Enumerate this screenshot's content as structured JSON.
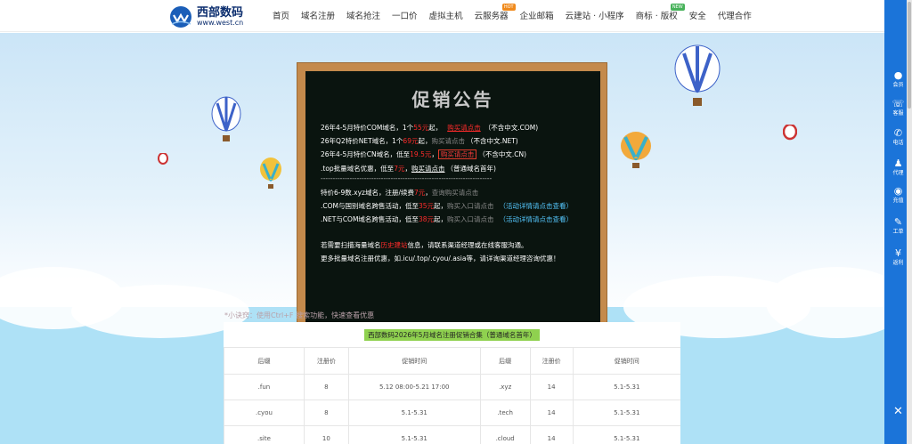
{
  "logo": {
    "name": "西部数码",
    "url": "www.west.cn"
  },
  "nav": [
    {
      "label": "首页"
    },
    {
      "label": "域名注册"
    },
    {
      "label": "域名抢注"
    },
    {
      "label": "一口价"
    },
    {
      "label": "虚拟主机"
    },
    {
      "label": "云服务器",
      "badge": "HOT"
    },
    {
      "label": "企业邮箱"
    },
    {
      "label": "云建站 · 小程序"
    },
    {
      "label": "商标 · 版权",
      "badge": "NEW"
    },
    {
      "label": "安全"
    },
    {
      "label": "代理合作"
    }
  ],
  "right_sidebar": [
    {
      "label": "会员",
      "icon": "user-icon"
    },
    {
      "label": "客服",
      "icon": "headset-icon"
    },
    {
      "label": "电话",
      "icon": "phone-icon"
    },
    {
      "label": "代理",
      "icon": "agent-icon"
    },
    {
      "label": "充值",
      "icon": "moneybag-icon"
    },
    {
      "label": "工单",
      "icon": "ticket-icon"
    },
    {
      "label": "返利",
      "icon": "rebate-icon"
    }
  ],
  "close_glyph": "✕",
  "notice": {
    "title": "促销公告",
    "line1": {
      "a": "26年4-5月特价COM域名，1个",
      "price": "55元",
      "b": "起，",
      "link": "购买请点击",
      "note": "（不含中文.COM)"
    },
    "line2": {
      "a": "26年Q2特价NET域名，1个",
      "price": "69元",
      "b": "起，",
      "link": "购买请点击",
      "note": "（不含中文.NET)"
    },
    "line3": {
      "a": "26年4-5月特价CN域名，低至",
      "price": "19.5元",
      "b": "，",
      "link": "购买请点击",
      "note": "（不含中文.CN)"
    },
    "line4": {
      "a": ".top批量域名优惠，低至",
      "price": "7元",
      "b": "，",
      "link": "购买请点击",
      "note": "（普通域名首年)"
    },
    "divider": "-----------------------------------------------------------------------",
    "line5": {
      "a": "特价6-9数.xyz域名，注册/续费",
      "price": "7元",
      "b": "，",
      "link": "查询购买请点击"
    },
    "line6": {
      "a": ".COM与国别域名跨售活动，低至",
      "price": "35元",
      "b": "起，",
      "link": "购买入口请点击",
      "note": "（活动详情请点击查看）"
    },
    "line7": {
      "a": ".NET与COM域名跨售活动，低至",
      "price": "38元",
      "b": "起，",
      "link": "购买入口请点击",
      "note": "（活动详情请点击查看）"
    },
    "line8": {
      "a": "若需要扫描海量域名",
      "red": "历史建站",
      "b": "信息，请联系渠道经理或在线客服沟通。"
    },
    "line9": "更多批量域名注册优惠，如.icu/.top/.cyou/.asia等，请详询渠道经理咨询优惠！"
  },
  "tip": "*小诀窍：使用Ctrl+F 搜索功能，快速查看优惠",
  "promo": {
    "title": "西部数码2026年5月域名注册促销合集（普通域名首年）",
    "headers": [
      "后缀",
      "注册价",
      "促销时间",
      "后缀",
      "注册价",
      "促销时间"
    ],
    "rows": [
      [
        ".fun",
        "8",
        "5.12 08:00-5.21 17:00",
        ".xyz",
        "14",
        "5.1-5.31"
      ],
      [
        ".cyou",
        "8",
        "5.1-5.31",
        ".tech",
        "14",
        "5.1-5.31"
      ],
      [
        ".site",
        "10",
        "5.1-5.31",
        ".cloud",
        "14",
        "5.1-5.31"
      ]
    ]
  },
  "colors": {
    "primary_blue": "#1b74d9",
    "board_bg": "#0a140f",
    "frame": "#c48a4c",
    "price_red": "#ff2b2b",
    "highlight_green": "#8fd14f",
    "sky": "#aee1f6"
  }
}
